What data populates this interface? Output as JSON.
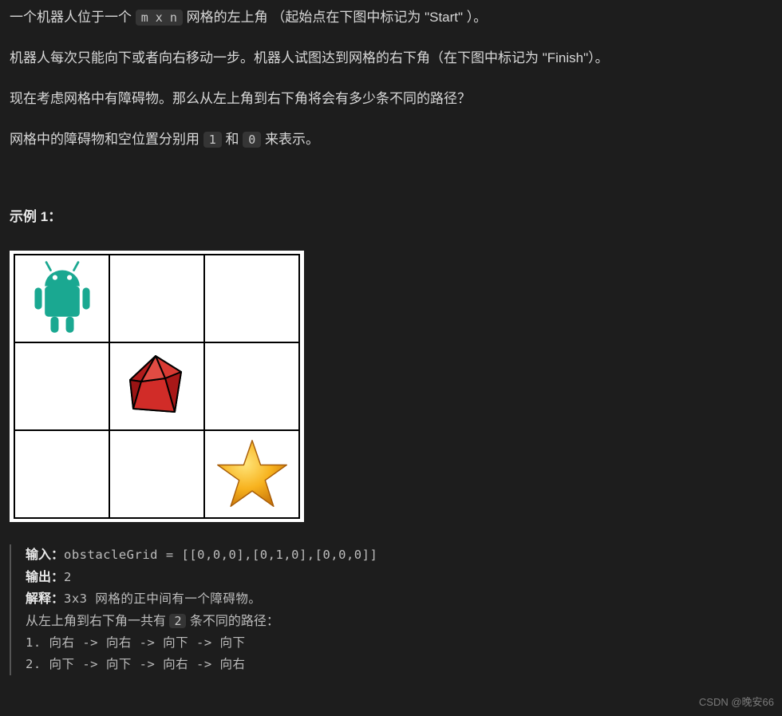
{
  "desc": {
    "p1_a": "一个机器人位于一个 ",
    "p1_code": "m x n",
    "p1_b": " 网格的左上角 （起始点在下图中标记为 \"Start\" ）。",
    "p2": "机器人每次只能向下或者向右移动一步。机器人试图达到网格的右下角（在下图中标记为 \"Finish\"）。",
    "p3": "现在考虑网格中有障碍物。那么从左上角到右下角将会有多少条不同的路径？",
    "p4_a": "网格中的障碍物和空位置分别用 ",
    "p4_c1": "1",
    "p4_b": " 和 ",
    "p4_c2": "0",
    "p4_c": " 来表示。"
  },
  "example_heading": "示例 1：",
  "grid_icons": {
    "robot": "robot",
    "obstacle": "ruby",
    "finish": "star"
  },
  "io": {
    "input_label": "输入：",
    "input_value": "obstacleGrid = [[0,0,0],[0,1,0],[0,0,0]]",
    "output_label": "输出：",
    "output_value": "2",
    "explain_label": "解释：",
    "explain_value": "3x3 网格的正中间有一个障碍物。",
    "paths_intro_a": "从左上角到右下角一共有 ",
    "paths_count": "2",
    "paths_intro_b": " 条不同的路径：",
    "path1": "1. 向右 -> 向右 -> 向下 -> 向下",
    "path2": "2. 向下 -> 向下 -> 向右 -> 向右"
  },
  "watermark": "CSDN @晚安66"
}
